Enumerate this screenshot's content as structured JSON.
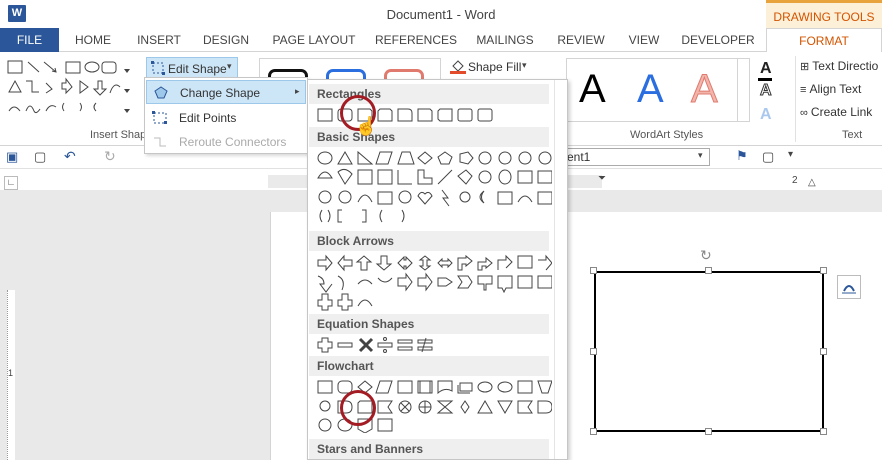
{
  "window": {
    "title": "Document1 - Word",
    "app_icon": "W",
    "contextual_tab": "DRAWING TOOLS"
  },
  "tabs": [
    "FILE",
    "HOME",
    "INSERT",
    "DESIGN",
    "PAGE LAYOUT",
    "REFERENCES",
    "MAILINGS",
    "REVIEW",
    "VIEW",
    "DEVELOPER",
    "FORMAT"
  ],
  "ribbon": {
    "insert_shapes_label": "Insert Shap",
    "edit_shape_label": "Edit Shape",
    "shape_fill_label": "Shape Fill",
    "wordart_label": "WordArt Styles",
    "wordart_letters": [
      "A",
      "A",
      "A"
    ],
    "text_group_label": "Text",
    "text_direction_label": "Text Directio",
    "align_text_label": "Align Text",
    "create_link_label": "Create Link"
  },
  "edit_menu": {
    "change_shape": "Change Shape",
    "edit_points": "Edit Points",
    "reroute_connectors": "Reroute Connectors"
  },
  "quick_access": {
    "name_box": "ent1"
  },
  "ruler": {
    "marks": [
      "1",
      "2"
    ],
    "left_mark": "1"
  },
  "gallery": {
    "categories": [
      "Rectangles",
      "Basic Shapes",
      "Block Arrows",
      "Equation Shapes",
      "Flowchart",
      "Stars and Banners"
    ]
  },
  "colors": {
    "word_blue": "#2b579a",
    "format_orange": "#d35400",
    "highlight": "#cde6f7",
    "annotation_red": "#a31b23"
  }
}
